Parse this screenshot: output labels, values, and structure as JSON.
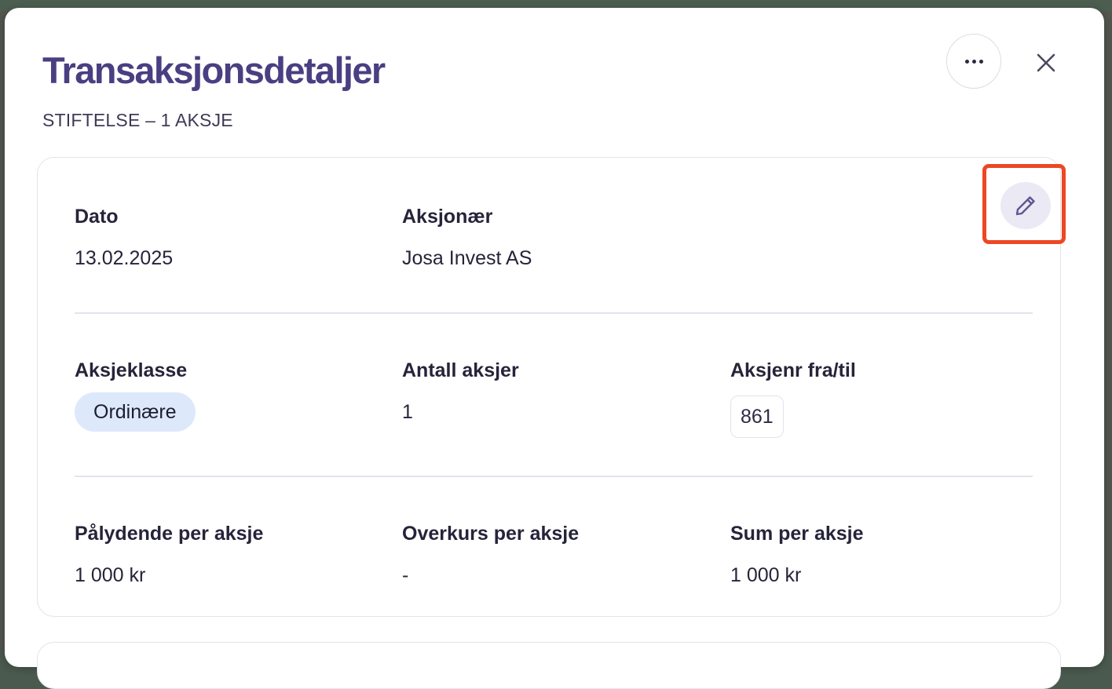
{
  "modal": {
    "title": "Transaksjonsdetaljer",
    "subtitle": "STIFTELSE – 1 AKSJE",
    "more_icon": "more-horizontal-icon",
    "close_icon": "close-icon",
    "edit_icon": "pencil-icon",
    "highlight_color": "#ee4723",
    "title_color": "#4a3f82"
  },
  "details": {
    "date_label": "Dato",
    "date_value": "13.02.2025",
    "shareholder_label": "Aksjonær",
    "shareholder_value": "Josa Invest AS",
    "share_class_label": "Aksjeklasse",
    "share_class_value": "Ordinære",
    "share_count_label": "Antall aksjer",
    "share_count_value": "1",
    "share_numbers_label": "Aksjenr fra/til",
    "share_numbers_value": "861",
    "nominal_label": "Pålydende per aksje",
    "nominal_value": "1 000 kr",
    "premium_label": "Overkurs per aksje",
    "premium_value": "-",
    "sum_label": "Sum per aksje",
    "sum_value": "1 000 kr"
  }
}
